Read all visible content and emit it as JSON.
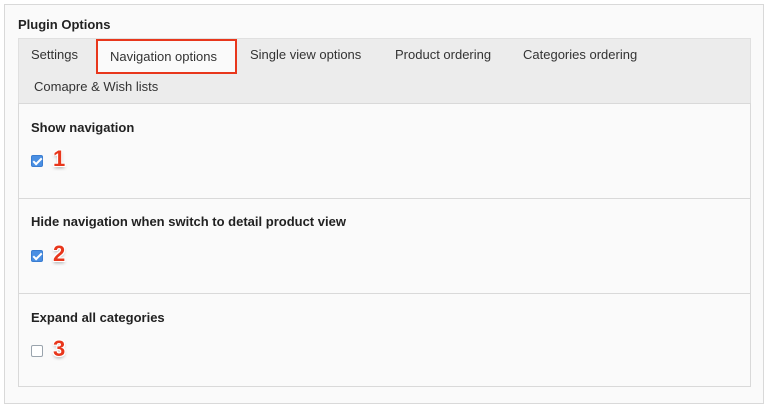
{
  "header": {
    "title": "Plugin Options"
  },
  "tabs": [
    {
      "label": "Settings"
    },
    {
      "label": "Navigation options",
      "active": true
    },
    {
      "label": "Single view options"
    },
    {
      "label": "Product ordering"
    },
    {
      "label": "Categories ordering"
    },
    {
      "label": "Comapre & Wish lists"
    }
  ],
  "options": [
    {
      "label": "Show navigation",
      "checked": true,
      "annotation": "1"
    },
    {
      "label": "Hide navigation when switch to detail product view",
      "checked": true,
      "annotation": "2"
    },
    {
      "label": "Expand all categories",
      "checked": false,
      "annotation": "3"
    }
  ],
  "colors": {
    "accent_red": "#e8371c",
    "checkbox_blue": "#4a8fe3",
    "tabbar_bg": "#ececec"
  }
}
